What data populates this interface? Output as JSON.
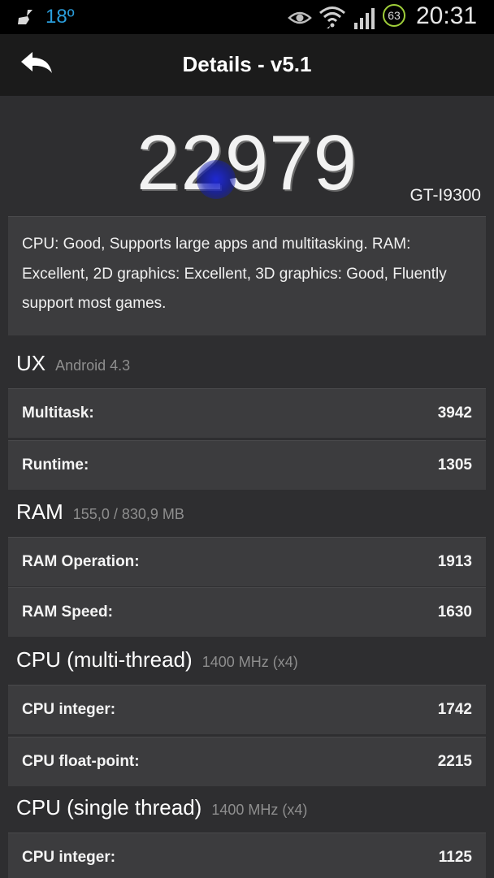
{
  "status_bar": {
    "temperature": "18º",
    "battery": "63",
    "time": "20:31",
    "icons": [
      "broom-icon",
      "eye-icon",
      "wifi-icon",
      "signal-icon",
      "battery-icon"
    ],
    "accent": "#2a9ddb",
    "battery_ring": "#9fce3a"
  },
  "header": {
    "title": "Details - v5.1"
  },
  "score": {
    "value": "22979",
    "device": "GT-I9300"
  },
  "summary": "CPU: Good, Supports large apps and multitasking. RAM: Excellent, 2D graphics: Excellent, 3D graphics: Good, Fluently support most games.",
  "sections": {
    "ux": {
      "title": "UX",
      "subtitle": "Android 4.3",
      "rows": [
        {
          "label": "Multitask:",
          "value": "3942"
        },
        {
          "label": "Runtime:",
          "value": "1305"
        }
      ]
    },
    "ram": {
      "title": "RAM",
      "subtitle": "155,0 / 830,9 MB",
      "rows": [
        {
          "label": "RAM Operation:",
          "value": "1913"
        },
        {
          "label": "RAM Speed:",
          "value": "1630"
        }
      ]
    },
    "cpu_multi": {
      "title": "CPU (multi-thread)",
      "subtitle": "1400 MHz (x4)",
      "rows": [
        {
          "label": "CPU integer:",
          "value": "1742"
        },
        {
          "label": "CPU float-point:",
          "value": "2215"
        }
      ]
    },
    "cpu_single": {
      "title": "CPU (single thread)",
      "subtitle": "1400 MHz (x4)",
      "rows": [
        {
          "label": "CPU integer:",
          "value": "1125"
        }
      ]
    }
  }
}
